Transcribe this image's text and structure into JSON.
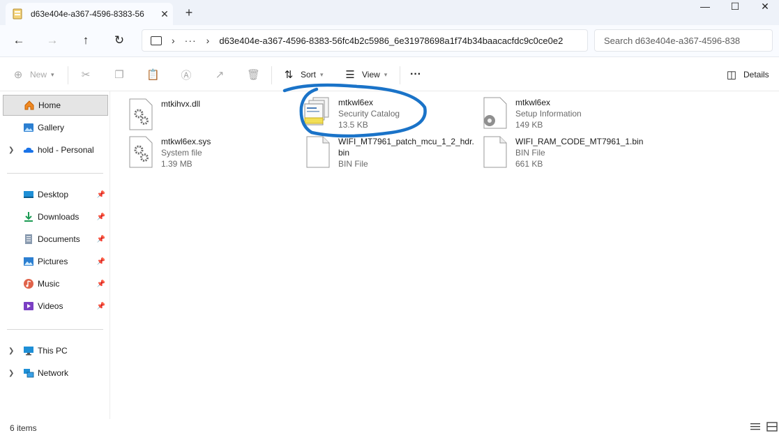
{
  "window": {
    "tab_title": "d63e404e-a367-4596-8383-56",
    "tab_close": "✕",
    "new_tab": "+",
    "minimize": "—",
    "maximize": "☐",
    "close": "✕"
  },
  "address": {
    "back": "←",
    "forward": "→",
    "up": "↑",
    "refresh": "↻",
    "separator": "›",
    "more": "···",
    "path": "d63e404e-a367-4596-8383-56fc4b2c5986_6e31978698a1f74b34baacacfdc9c0ce0e2",
    "search_placeholder": "Search d63e404e-a367-4596-838"
  },
  "commands": {
    "new_label": "New",
    "sort_label": "Sort",
    "view_label": "View",
    "more": "···",
    "details_label": "Details"
  },
  "sidebar": {
    "items": [
      {
        "label": "Home",
        "icon": "home-icon",
        "selected": true
      },
      {
        "label": "Gallery",
        "icon": "gallery-icon"
      },
      {
        "label": "hold - Personal",
        "icon": "onedrive-cloud-icon",
        "expandable": true
      }
    ],
    "quick_access": [
      {
        "label": "Desktop",
        "icon": "desktop-icon",
        "pinned": true
      },
      {
        "label": "Downloads",
        "icon": "downloads-icon",
        "pinned": true
      },
      {
        "label": "Documents",
        "icon": "documents-icon",
        "pinned": true
      },
      {
        "label": "Pictures",
        "icon": "pictures-icon",
        "pinned": true
      },
      {
        "label": "Music",
        "icon": "music-icon",
        "pinned": true
      },
      {
        "label": "Videos",
        "icon": "videos-icon",
        "pinned": true
      }
    ],
    "locations": [
      {
        "label": "This PC",
        "icon": "this-pc-icon",
        "expandable": true
      },
      {
        "label": "Network",
        "icon": "network-icon",
        "expandable": true
      }
    ]
  },
  "files": [
    {
      "name": "mtkihvx.dll",
      "type": "",
      "size": "",
      "icon": "settings-file-icon"
    },
    {
      "name": "mtkwl6ex",
      "type": "Security Catalog",
      "size": "13.5 KB",
      "icon": "security-catalog-icon"
    },
    {
      "name": "mtkwl6ex",
      "type": "Setup Information",
      "size": "149 KB",
      "icon": "setup-information-icon"
    },
    {
      "name": "mtkwl6ex.sys",
      "type": "System file",
      "size": "1.39 MB",
      "icon": "system-file-icon"
    },
    {
      "name": "WIFI_MT7961_patch_mcu_1_2_hdr.bin",
      "type": "BIN File",
      "size": "",
      "icon": "blank-file-icon"
    },
    {
      "name": "WIFI_RAM_CODE_MT7961_1.bin",
      "type": "BIN File",
      "size": "661 KB",
      "icon": "blank-file-icon"
    }
  ],
  "annotation": {
    "color": "#1a73c8"
  },
  "status": {
    "item_count": "6 items"
  },
  "colors": {
    "accent": "#005fb8",
    "selected_bg": "#e5e5e5",
    "chrome_bg": "#eef2f9"
  }
}
